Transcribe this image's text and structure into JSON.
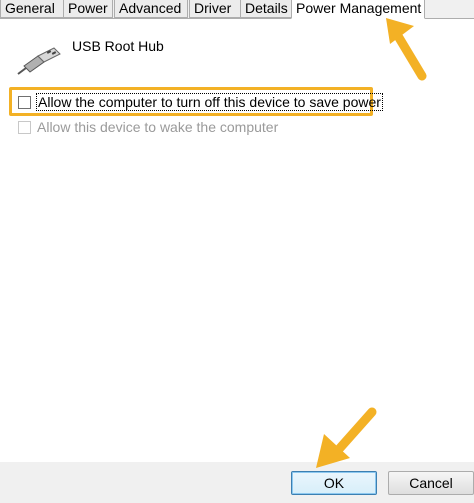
{
  "tabs": [
    {
      "label": "General",
      "active": false
    },
    {
      "label": "Power",
      "active": false
    },
    {
      "label": "Advanced",
      "active": false
    },
    {
      "label": "Driver",
      "active": false
    },
    {
      "label": "Details",
      "active": false
    },
    {
      "label": "Power Management",
      "active": true
    }
  ],
  "device": {
    "name": "USB Root Hub",
    "icon": "usb-plug-icon"
  },
  "options": {
    "allow_turn_off": {
      "label": "Allow the computer to turn off this device to save power",
      "checked": false,
      "enabled": true
    },
    "allow_wake": {
      "label": "Allow this device to wake the computer",
      "checked": false,
      "enabled": false
    }
  },
  "buttons": {
    "ok": "OK",
    "cancel": "Cancel"
  },
  "colors": {
    "highlight": "#f3b125",
    "arrow": "#f3b125"
  }
}
